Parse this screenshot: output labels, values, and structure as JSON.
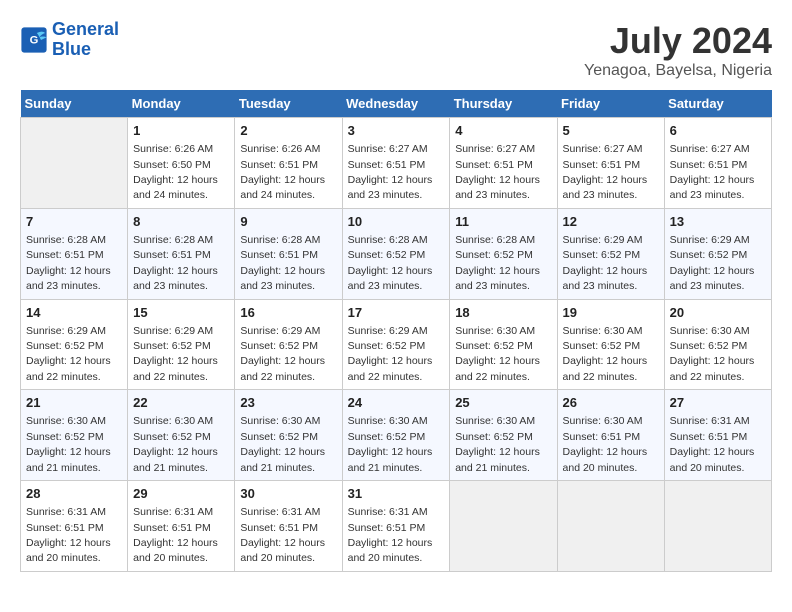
{
  "header": {
    "logo_line1": "General",
    "logo_line2": "Blue",
    "month_year": "July 2024",
    "location": "Yenagoa, Bayelsa, Nigeria"
  },
  "weekdays": [
    "Sunday",
    "Monday",
    "Tuesday",
    "Wednesday",
    "Thursday",
    "Friday",
    "Saturday"
  ],
  "weeks": [
    [
      {
        "day": "",
        "sunrise": "",
        "sunset": "",
        "daylight": ""
      },
      {
        "day": "1",
        "sunrise": "6:26 AM",
        "sunset": "6:50 PM",
        "daylight": "12 hours and 24 minutes."
      },
      {
        "day": "2",
        "sunrise": "6:26 AM",
        "sunset": "6:51 PM",
        "daylight": "12 hours and 24 minutes."
      },
      {
        "day": "3",
        "sunrise": "6:27 AM",
        "sunset": "6:51 PM",
        "daylight": "12 hours and 23 minutes."
      },
      {
        "day": "4",
        "sunrise": "6:27 AM",
        "sunset": "6:51 PM",
        "daylight": "12 hours and 23 minutes."
      },
      {
        "day": "5",
        "sunrise": "6:27 AM",
        "sunset": "6:51 PM",
        "daylight": "12 hours and 23 minutes."
      },
      {
        "day": "6",
        "sunrise": "6:27 AM",
        "sunset": "6:51 PM",
        "daylight": "12 hours and 23 minutes."
      }
    ],
    [
      {
        "day": "7",
        "sunrise": "6:28 AM",
        "sunset": "6:51 PM",
        "daylight": "12 hours and 23 minutes."
      },
      {
        "day": "8",
        "sunrise": "6:28 AM",
        "sunset": "6:51 PM",
        "daylight": "12 hours and 23 minutes."
      },
      {
        "day": "9",
        "sunrise": "6:28 AM",
        "sunset": "6:51 PM",
        "daylight": "12 hours and 23 minutes."
      },
      {
        "day": "10",
        "sunrise": "6:28 AM",
        "sunset": "6:52 PM",
        "daylight": "12 hours and 23 minutes."
      },
      {
        "day": "11",
        "sunrise": "6:28 AM",
        "sunset": "6:52 PM",
        "daylight": "12 hours and 23 minutes."
      },
      {
        "day": "12",
        "sunrise": "6:29 AM",
        "sunset": "6:52 PM",
        "daylight": "12 hours and 23 minutes."
      },
      {
        "day": "13",
        "sunrise": "6:29 AM",
        "sunset": "6:52 PM",
        "daylight": "12 hours and 23 minutes."
      }
    ],
    [
      {
        "day": "14",
        "sunrise": "6:29 AM",
        "sunset": "6:52 PM",
        "daylight": "12 hours and 22 minutes."
      },
      {
        "day": "15",
        "sunrise": "6:29 AM",
        "sunset": "6:52 PM",
        "daylight": "12 hours and 22 minutes."
      },
      {
        "day": "16",
        "sunrise": "6:29 AM",
        "sunset": "6:52 PM",
        "daylight": "12 hours and 22 minutes."
      },
      {
        "day": "17",
        "sunrise": "6:29 AM",
        "sunset": "6:52 PM",
        "daylight": "12 hours and 22 minutes."
      },
      {
        "day": "18",
        "sunrise": "6:30 AM",
        "sunset": "6:52 PM",
        "daylight": "12 hours and 22 minutes."
      },
      {
        "day": "19",
        "sunrise": "6:30 AM",
        "sunset": "6:52 PM",
        "daylight": "12 hours and 22 minutes."
      },
      {
        "day": "20",
        "sunrise": "6:30 AM",
        "sunset": "6:52 PM",
        "daylight": "12 hours and 22 minutes."
      }
    ],
    [
      {
        "day": "21",
        "sunrise": "6:30 AM",
        "sunset": "6:52 PM",
        "daylight": "12 hours and 21 minutes."
      },
      {
        "day": "22",
        "sunrise": "6:30 AM",
        "sunset": "6:52 PM",
        "daylight": "12 hours and 21 minutes."
      },
      {
        "day": "23",
        "sunrise": "6:30 AM",
        "sunset": "6:52 PM",
        "daylight": "12 hours and 21 minutes."
      },
      {
        "day": "24",
        "sunrise": "6:30 AM",
        "sunset": "6:52 PM",
        "daylight": "12 hours and 21 minutes."
      },
      {
        "day": "25",
        "sunrise": "6:30 AM",
        "sunset": "6:52 PM",
        "daylight": "12 hours and 21 minutes."
      },
      {
        "day": "26",
        "sunrise": "6:30 AM",
        "sunset": "6:51 PM",
        "daylight": "12 hours and 20 minutes."
      },
      {
        "day": "27",
        "sunrise": "6:31 AM",
        "sunset": "6:51 PM",
        "daylight": "12 hours and 20 minutes."
      }
    ],
    [
      {
        "day": "28",
        "sunrise": "6:31 AM",
        "sunset": "6:51 PM",
        "daylight": "12 hours and 20 minutes."
      },
      {
        "day": "29",
        "sunrise": "6:31 AM",
        "sunset": "6:51 PM",
        "daylight": "12 hours and 20 minutes."
      },
      {
        "day": "30",
        "sunrise": "6:31 AM",
        "sunset": "6:51 PM",
        "daylight": "12 hours and 20 minutes."
      },
      {
        "day": "31",
        "sunrise": "6:31 AM",
        "sunset": "6:51 PM",
        "daylight": "12 hours and 20 minutes."
      },
      {
        "day": "",
        "sunrise": "",
        "sunset": "",
        "daylight": ""
      },
      {
        "day": "",
        "sunrise": "",
        "sunset": "",
        "daylight": ""
      },
      {
        "day": "",
        "sunrise": "",
        "sunset": "",
        "daylight": ""
      }
    ]
  ]
}
